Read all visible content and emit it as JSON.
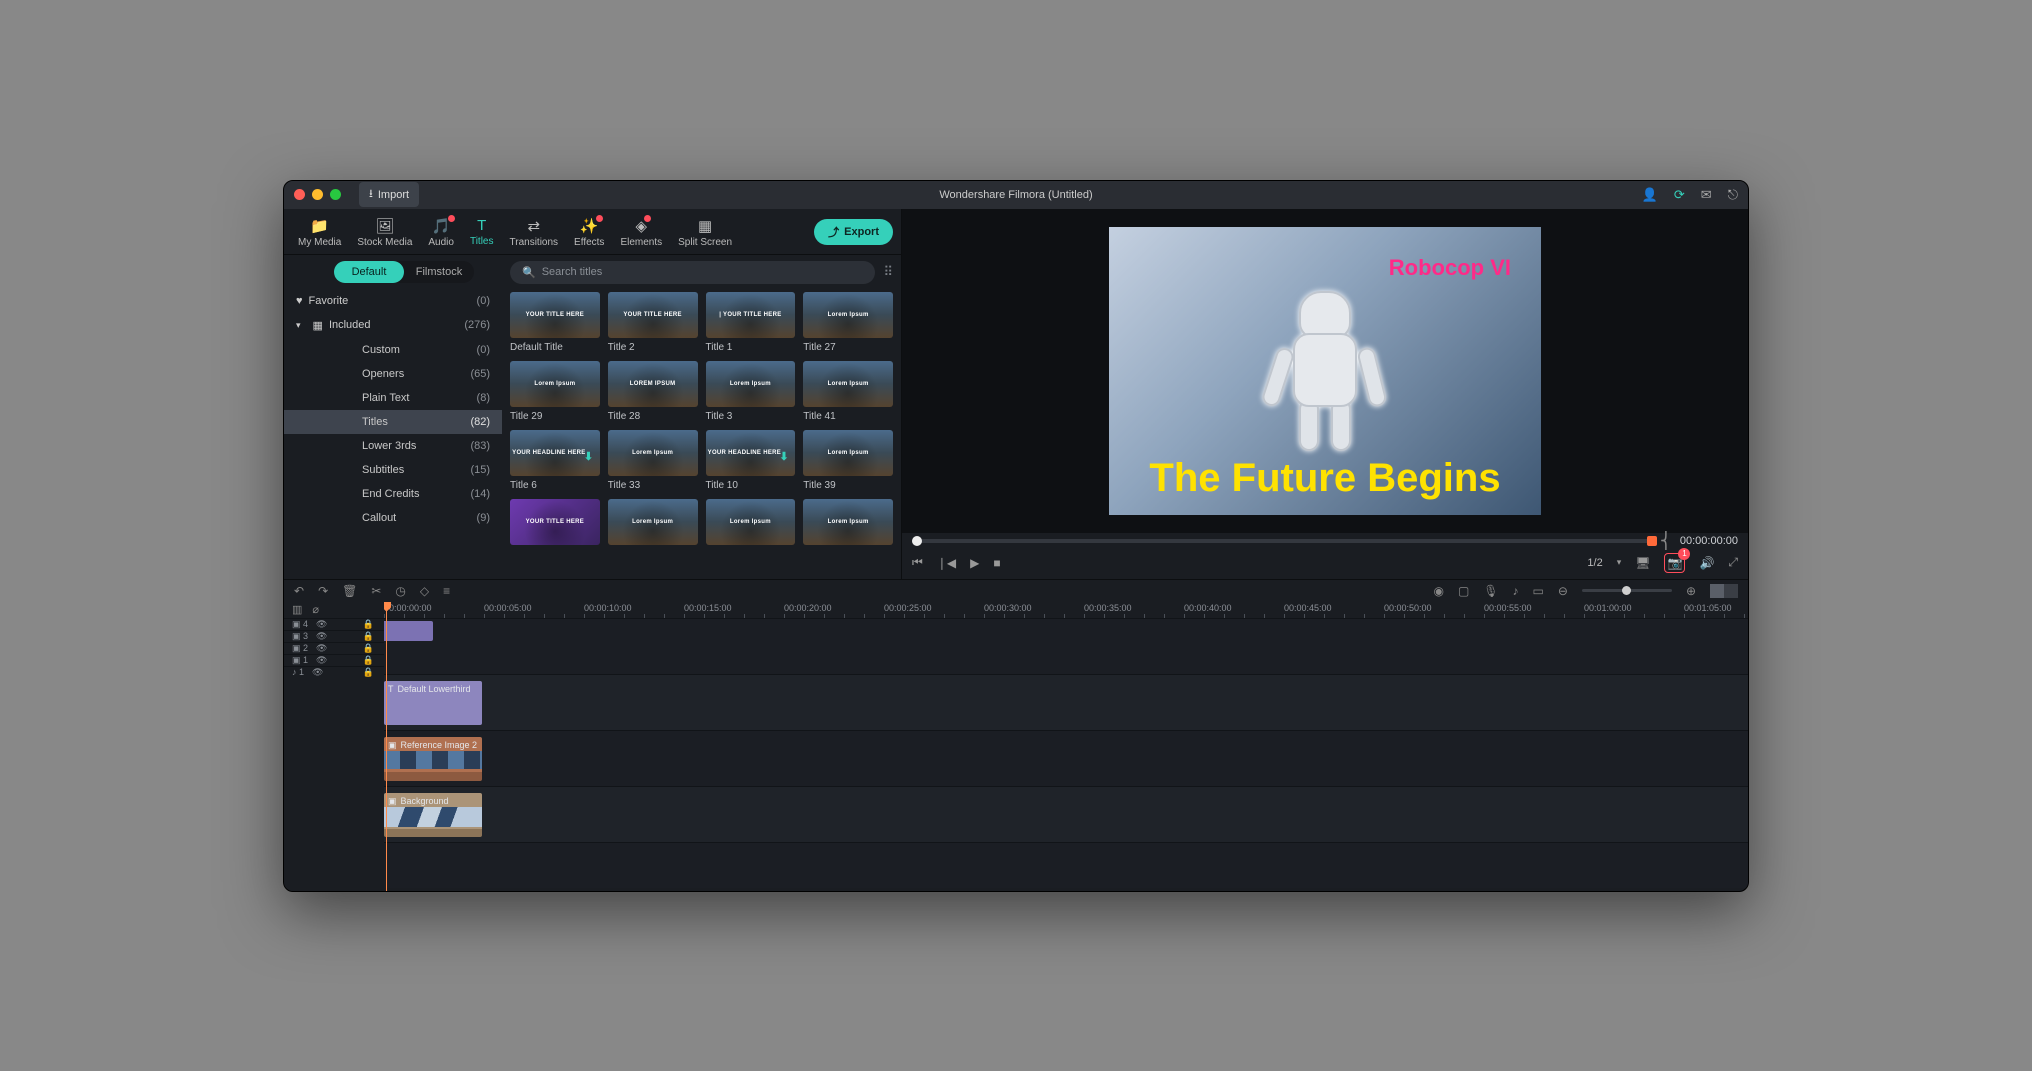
{
  "titlebar": {
    "import": "Import",
    "title": "Wondershare Filmora (Untitled)"
  },
  "tabs": [
    {
      "label": "My Media",
      "icon": "📁"
    },
    {
      "label": "Stock Media",
      "icon": "🖼"
    },
    {
      "label": "Audio",
      "icon": "🎵",
      "dot": true
    },
    {
      "label": "Titles",
      "icon": "T",
      "active": true
    },
    {
      "label": "Transitions",
      "icon": "⇄"
    },
    {
      "label": "Effects",
      "icon": "✨",
      "dot": true
    },
    {
      "label": "Elements",
      "icon": "◈",
      "dot": true
    },
    {
      "label": "Split Screen",
      "icon": "▦"
    }
  ],
  "export": "Export",
  "libtabs": {
    "a": "Default",
    "b": "Filmstock"
  },
  "search_ph": "Search titles",
  "cats": [
    {
      "label": "Favorite",
      "count": "(0)",
      "icon": "♥",
      "head": true
    },
    {
      "label": "Included",
      "count": "(276)",
      "icon": "▦",
      "head": true,
      "chev": true
    },
    {
      "label": "Custom",
      "count": "(0)",
      "sub": true
    },
    {
      "label": "Openers",
      "count": "(65)",
      "sub": true
    },
    {
      "label": "Plain Text",
      "count": "(8)",
      "sub": true
    },
    {
      "label": "Titles",
      "count": "(82)",
      "sub": true,
      "sel": true
    },
    {
      "label": "Lower 3rds",
      "count": "(83)",
      "sub": true
    },
    {
      "label": "Subtitles",
      "count": "(15)",
      "sub": true
    },
    {
      "label": "End Credits",
      "count": "(14)",
      "sub": true
    },
    {
      "label": "Callout",
      "count": "(9)",
      "sub": true
    }
  ],
  "tiles": [
    {
      "label": "Default Title",
      "txt": "YOUR TITLE HERE"
    },
    {
      "label": "Title 2",
      "txt": "YOUR TITLE HERE"
    },
    {
      "label": "Title 1",
      "txt": "| YOUR TITLE HERE"
    },
    {
      "label": "Title 27",
      "txt": "Lorem Ipsum"
    },
    {
      "label": "Title 29",
      "txt": "Lorem Ipsum"
    },
    {
      "label": "Title 28",
      "txt": "LOREM IPSUM"
    },
    {
      "label": "Title 3",
      "txt": "Lorem Ipsum"
    },
    {
      "label": "Title 41",
      "txt": "Lorem Ipsum"
    },
    {
      "label": "Title 6",
      "txt": "YOUR HEADLINE HERE",
      "dl": true
    },
    {
      "label": "Title 33",
      "txt": "Lorem Ipsum"
    },
    {
      "label": "Title 10",
      "txt": "YOUR HEADLINE HERE",
      "dl": true
    },
    {
      "label": "Title 39",
      "txt": "Lorem Ipsum"
    },
    {
      "label": "",
      "txt": "YOUR TITLE HERE",
      "pur": true
    },
    {
      "label": "",
      "txt": "Lorem Ipsum"
    },
    {
      "label": "",
      "txt": "Lorem Ipsum"
    },
    {
      "label": "",
      "txt": "Lorem Ipsum"
    }
  ],
  "preview": {
    "t1": "Robocop VI",
    "t2": "The Future Begins",
    "time": "00:00:00:00",
    "scale": "1/2",
    "badge": "1"
  },
  "ruler": [
    "00:00:00:00",
    "00:00:05:00",
    "00:00:10:00",
    "00:00:15:00",
    "00:00:20:00",
    "00:00:25:00",
    "00:00:30:00",
    "00:00:35:00",
    "00:00:40:00",
    "00:00:45:00",
    "00:00:50:00",
    "00:00:55:00",
    "00:01:00:00",
    "00:01:05:00"
  ],
  "tracks": [
    {
      "id": "▣ 4"
    },
    {
      "id": "▣ 3"
    },
    {
      "id": "▣ 2"
    },
    {
      "id": "▣ 1"
    },
    {
      "id": "♪ 1",
      "aud": true
    }
  ],
  "clips": {
    "c1": "Default Lowerthird",
    "c2": "Reference Image 2",
    "c3": "Background"
  }
}
